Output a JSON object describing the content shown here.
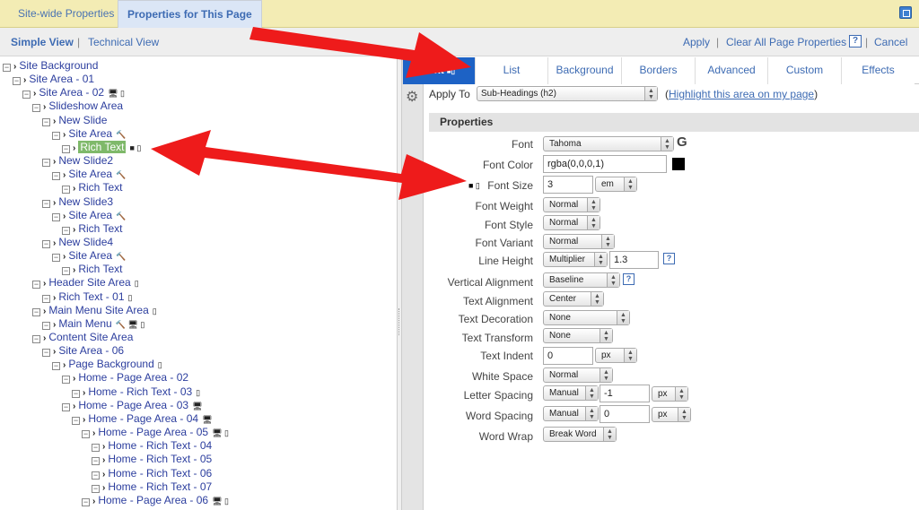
{
  "top_tabs": [
    "Site-wide Properties",
    "Properties for This Page"
  ],
  "views": {
    "simple": "Simple View",
    "sep": "|",
    "technical": "Technical View"
  },
  "actions": {
    "apply": "Apply",
    "sep": "|",
    "clear": "Clear All Page Properties",
    "help": "?",
    "cancel": "Cancel"
  },
  "tree": [
    {
      "label": "Site Background",
      "icons": ""
    },
    {
      "label": "Site Area - 01",
      "icons": ""
    },
    {
      "label": "Site Area - 02",
      "icons": "🖥 ▯"
    },
    {
      "label": "Slideshow Area",
      "icons": ""
    },
    {
      "label": "New Slide",
      "icons": ""
    },
    {
      "label": "Site Area",
      "icons": "🔨"
    },
    {
      "label": "Rich Text",
      "icons": "■ ▯"
    },
    {
      "label": "New Slide2",
      "icons": ""
    },
    {
      "label": "Site Area",
      "icons": "🔨"
    },
    {
      "label": "Rich Text",
      "icons": ""
    },
    {
      "label": "New Slide3",
      "icons": ""
    },
    {
      "label": "Site Area",
      "icons": "🔨"
    },
    {
      "label": "Rich Text",
      "icons": ""
    },
    {
      "label": "New Slide4",
      "icons": ""
    },
    {
      "label": "Site Area",
      "icons": "🔨"
    },
    {
      "label": "Rich Text",
      "icons": ""
    },
    {
      "label": "Header Site Area",
      "icons": "▯"
    },
    {
      "label": "Rich Text - 01",
      "icons": "▯"
    },
    {
      "label": "Main Menu Site Area",
      "icons": "▯"
    },
    {
      "label": "Main Menu",
      "icons": "🔨 🖥 ▯"
    },
    {
      "label": "Content Site Area",
      "icons": ""
    },
    {
      "label": "Site Area - 06",
      "icons": ""
    },
    {
      "label": "Page Background",
      "icons": "▯"
    },
    {
      "label": "Home - Page Area - 02",
      "icons": ""
    },
    {
      "label": "Home - Rich Text - 03",
      "icons": "▯"
    },
    {
      "label": "Home - Page Area - 03",
      "icons": "🖥"
    },
    {
      "label": "Home - Page Area - 04",
      "icons": "🖥"
    },
    {
      "label": "Home - Page Area - 05",
      "icons": "🖥 ▯"
    },
    {
      "label": "Home - Rich Text - 04",
      "icons": ""
    },
    {
      "label": "Home - Rich Text - 05",
      "icons": ""
    },
    {
      "label": "Home - Rich Text - 06",
      "icons": ""
    },
    {
      "label": "Home - Rich Text - 07",
      "icons": ""
    },
    {
      "label": "Home - Page Area - 06",
      "icons": "🖥 ▯"
    }
  ],
  "right_tabs": [
    "Text",
    "List",
    "Background",
    "Borders",
    "Advanced",
    "Custom",
    "Effects"
  ],
  "apply_to": {
    "label": "Apply To",
    "value": "Sub-Headings (h2)",
    "paren_open": "(",
    "link": "Highlight this area on my page",
    "paren_close": ")"
  },
  "properties_title": "Properties",
  "props": {
    "font": {
      "label": "Font",
      "value": "Tahoma",
      "g": "G"
    },
    "font_color": {
      "label": "Font Color",
      "value": "rgba(0,0,0,1)",
      "swatch": "#000000"
    },
    "font_size": {
      "label": "Font Size",
      "value": "3",
      "unit": "em"
    },
    "font_weight": {
      "label": "Font Weight",
      "value": "Normal"
    },
    "font_style": {
      "label": "Font Style",
      "value": "Normal"
    },
    "font_variant": {
      "label": "Font Variant",
      "value": "Normal"
    },
    "line_height": {
      "label": "Line Height",
      "mode": "Multiplier",
      "value": "1.3"
    },
    "vertical_alignment": {
      "label": "Vertical Alignment",
      "value": "Baseline"
    },
    "text_alignment": {
      "label": "Text Alignment",
      "value": "Center"
    },
    "text_decoration": {
      "label": "Text Decoration",
      "value": "None"
    },
    "text_transform": {
      "label": "Text Transform",
      "value": "None"
    },
    "text_indent": {
      "label": "Text Indent",
      "value": "0",
      "unit": "px"
    },
    "white_space": {
      "label": "White Space",
      "value": "Normal"
    },
    "letter_spacing": {
      "label": "Letter Spacing",
      "mode": "Manual",
      "value": "-1",
      "unit": "px"
    },
    "word_spacing": {
      "label": "Word Spacing",
      "mode": "Manual",
      "value": "0",
      "unit": "px"
    },
    "word_wrap": {
      "label": "Word Wrap",
      "value": "Break Word"
    }
  },
  "colors": {
    "accent": "#1d62c5",
    "arrow": "#ee1b1b",
    "highlight": "#7fb96a",
    "topbar": "#f3ecb4"
  }
}
